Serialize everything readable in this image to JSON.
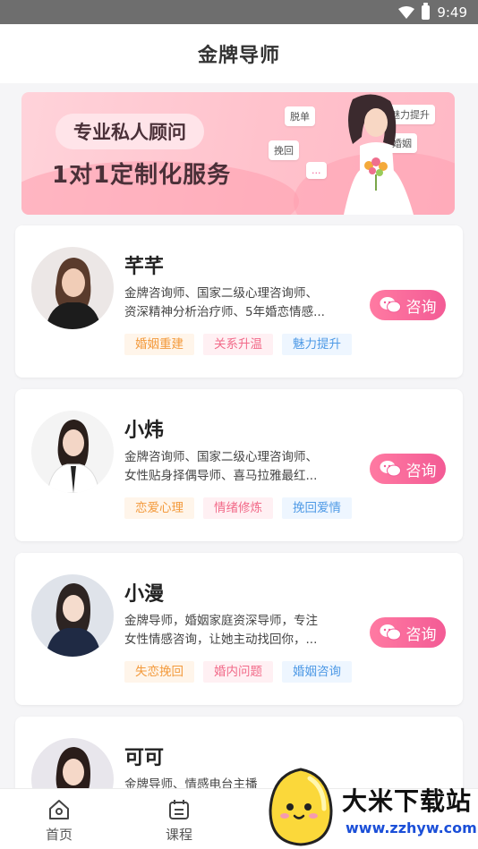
{
  "status_bar": {
    "time": "9:49"
  },
  "header": {
    "title": "金牌导师"
  },
  "banner": {
    "headline": "专业私人顾问",
    "subline": "1对1定制化服务",
    "bubbles": [
      "脱单",
      "魅力提升",
      "挽回",
      "婚姻",
      "..."
    ]
  },
  "consult_label": "咨询",
  "mentors": [
    {
      "name": "芊芊",
      "desc_line1": "金牌咨询师、国家二级心理咨询师、",
      "desc_line2": "资深精神分析治疗师、5年婚恋情感...",
      "tags": [
        {
          "label": "婚姻重建",
          "color": "orange"
        },
        {
          "label": "关系升温",
          "color": "pink"
        },
        {
          "label": "魅力提升",
          "color": "blue"
        }
      ]
    },
    {
      "name": "小炜",
      "desc_line1": "金牌咨询师、国家二级心理咨询师、",
      "desc_line2": "女性贴身择偶导师、喜马拉雅最红...",
      "tags": [
        {
          "label": "恋爱心理",
          "color": "orange"
        },
        {
          "label": "情绪修炼",
          "color": "pink"
        },
        {
          "label": "挽回爱情",
          "color": "blue"
        }
      ]
    },
    {
      "name": "小漫",
      "desc_line1": "金牌导师，婚姻家庭资深导师，专注",
      "desc_line2": "女性情感咨询，让她主动找回你，...",
      "tags": [
        {
          "label": "失恋挽回",
          "color": "orange"
        },
        {
          "label": "婚内问题",
          "color": "pink"
        },
        {
          "label": "婚姻咨询",
          "color": "blue"
        }
      ]
    },
    {
      "name": "可可",
      "desc_line1": "金牌导师、情感电台主播",
      "desc_line2": "",
      "tags": []
    }
  ],
  "tabbar": {
    "home": "首页",
    "course": "课程"
  },
  "watermark": {
    "text": "大米下载站",
    "url": "www.zzhyw.com"
  },
  "colors": {
    "accent": "#f35b95",
    "tag_orange": "#f39a3c",
    "tag_pink": "#f26b8a",
    "tag_blue": "#4f9ae6"
  }
}
